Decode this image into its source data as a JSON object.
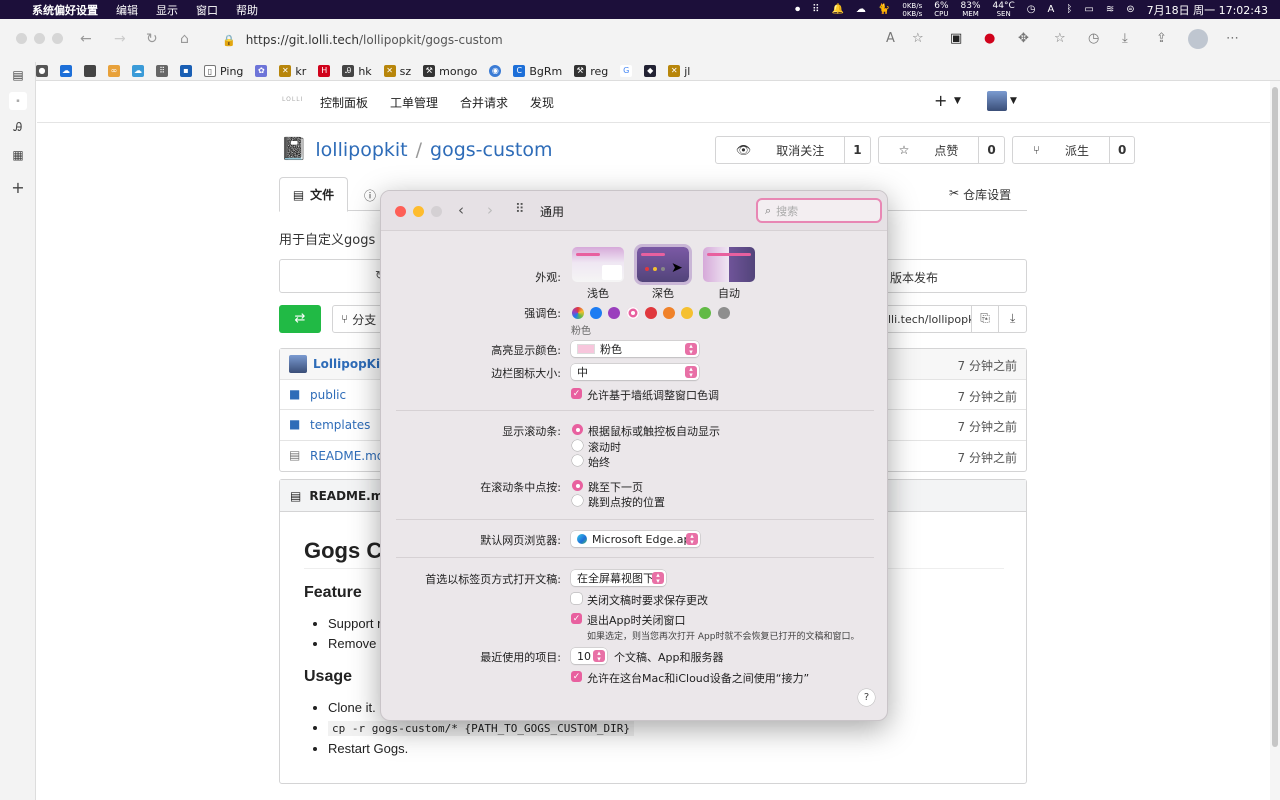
{
  "menubar": {
    "app_name": "系统偏好设置",
    "items": [
      "编辑",
      "显示",
      "窗口",
      "帮助"
    ],
    "net_up": "0KB/s",
    "net_down": "0KB/s",
    "cpu_value": "6%",
    "cpu_label": "CPU",
    "mem_value": "83%",
    "mem_label": "MEM",
    "sen_value": "44°C",
    "sen_label": "SEN",
    "datetime": "7月18日 周一 17:02:43"
  },
  "browser": {
    "url_host": "https://git.lolli.tech",
    "url_path": "/lollipopkit/gogs-custom",
    "bookmarks": [
      "Ping",
      "kr",
      "hk",
      "sz",
      "mongo",
      "BgRm",
      "reg",
      "jl"
    ]
  },
  "gogs": {
    "logo": "LOLLI",
    "nav": [
      "控制面板",
      "工单管理",
      "合并请求",
      "发现"
    ],
    "owner": "lollipopkit",
    "repo": "gogs-custom",
    "watch_label": "取消关注",
    "watch_count": "1",
    "star_label": "点赞",
    "star_count": "0",
    "fork_label": "派生",
    "fork_count": "0",
    "tab_files": "文件",
    "tab_settings": "仓库设置",
    "description": "用于自定义gogs U",
    "releases_label": "版本发布",
    "branch_label": "分支",
    "clone_url": "lli.tech/lollipopkit",
    "files": [
      {
        "name": "LollipopKit",
        "when": "7 分钟之前"
      },
      {
        "name": "public",
        "when": "7 分钟之前"
      },
      {
        "name": "templates",
        "when": "7 分钟之前"
      },
      {
        "name": "README.md",
        "when": "7 分钟之前"
      }
    ],
    "readme_title": "README.md",
    "readme": {
      "h1": "Gogs C",
      "h2_feature": "Feature",
      "feature_items": [
        "Support r",
        "Remove C"
      ],
      "h2_usage": "Usage",
      "usage_1": "Clone it.",
      "usage_2": "cp -r gogs-custom/* {PATH_TO_GOGS_CUSTOM_DIR}",
      "usage_3": "Restart Gogs."
    }
  },
  "prefs": {
    "title": "通用",
    "search_placeholder": "搜索",
    "appearance_label": "外观:",
    "appearance_options": [
      "浅色",
      "深色",
      "自动"
    ],
    "accent_label": "强调色:",
    "accent_selected_name": "粉色",
    "accent_colors": [
      "#8c8cf0",
      "#1d7cf2",
      "#9a3fbd",
      "#e8609f",
      "#e0383e",
      "#f0822a",
      "#f5c030",
      "#62ba46",
      "#8e8e8e"
    ],
    "highlight_label": "高亮显示颜色:",
    "highlight_value": "粉色",
    "sidebar_icon_label": "边栏图标大小:",
    "sidebar_icon_value": "中",
    "wallpaper_tint": "允许基于墙纸调整窗口色调",
    "scrollbars_label": "显示滚动条:",
    "scrollbar_options": [
      "根据鼠标或触控板自动显示",
      "滚动时",
      "始终"
    ],
    "click_label": "在滚动条中点按:",
    "click_options": [
      "跳至下一页",
      "跳到点按的位置"
    ],
    "browser_label": "默认网页浏览器:",
    "browser_value": "Microsoft Edge.app",
    "tabs_label": "首选以标签页方式打开文稿:",
    "tabs_value": "在全屏幕视图下",
    "ask_keep": "关闭文稿时要求保存更改",
    "close_windows": "退出App时关闭窗口",
    "close_windows_hint": "如果选定，则当您再次打开 App时就不会恢复已打开的文稿和窗口。",
    "recent_label": "最近使用的项目:",
    "recent_value": "10",
    "recent_suffix": "个文稿、App和服务器",
    "handoff": "允许在这台Mac和iCloud设备之间使用“接力”",
    "help": "?"
  }
}
